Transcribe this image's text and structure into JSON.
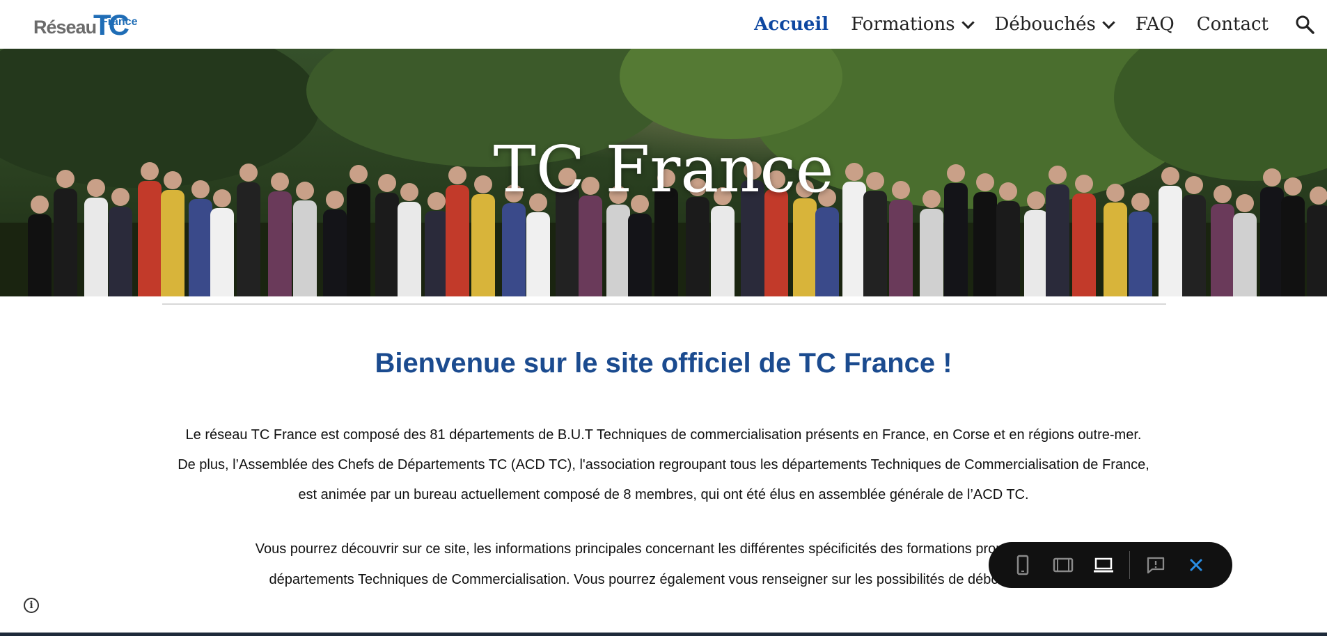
{
  "header": {
    "logo": {
      "word": "Réseau",
      "tc": "TC",
      "france": "France"
    },
    "nav": [
      {
        "label": "Accueil",
        "active": true
      },
      {
        "label": "Formations",
        "dropdown": true
      },
      {
        "label": "Débouchés",
        "dropdown": true
      },
      {
        "label": "FAQ"
      },
      {
        "label": "Contact"
      }
    ],
    "search_icon": "search-icon"
  },
  "hero": {
    "title": "TC France"
  },
  "main": {
    "heading": "Bienvenue sur le site officiel de TC France !",
    "paragraph1": [
      "Le réseau TC France est composé des 81 départements de B.U.T Techniques de commercialisation présents en France, en Corse et en régions outre-mer.",
      "De plus, l’Assemblée des Chefs de Départements TC (ACD TC), l'association regroupant tous les départements Techniques de Commercialisation de France,",
      "est animée par un bureau actuellement composé de 8 membres, qui ont été élus en assemblée générale de l’ACD TC."
    ],
    "paragraph2": [
      "Vous pourrez découvrir sur ce site, les informations principales concernant les différentes spécificités des formations proposées, et d",
      "départements Techniques de Commercialisation. Vous pourrez également vous renseigner sur les possibilités de débouchés d'é"
    ]
  },
  "toolbar": {
    "buttons": [
      "phone-view-icon",
      "tablet-view-icon",
      "laptop-view-icon",
      "feedback-icon",
      "close-icon"
    ]
  },
  "colors": {
    "accent": "#0d47a1",
    "heading": "#1b4b8f",
    "logo_blue": "#1f6db6",
    "toolbar_bg": "#111111"
  }
}
